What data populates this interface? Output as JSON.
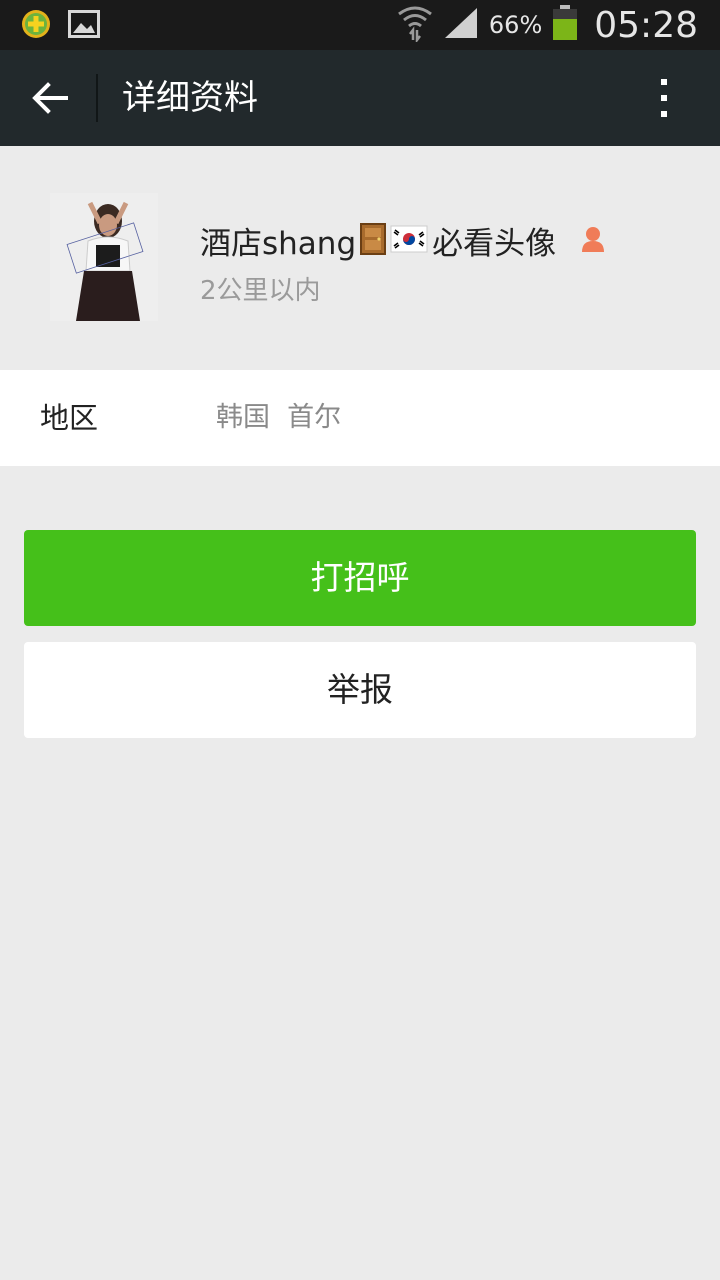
{
  "status_bar": {
    "icons_left": [
      "360-security-icon",
      "gallery-notification-icon"
    ],
    "battery_percent": "66%",
    "time": "05:28",
    "battery_level": 0.66
  },
  "action_bar": {
    "title": "详细资料"
  },
  "profile": {
    "nickname": "酒店shang",
    "nickname_suffix": "必看头像",
    "emoji_icons": [
      "door-emoji-icon",
      "korea-flag-emoji-icon"
    ],
    "gender_icon": "female-gender-icon",
    "distance": "2公里以内"
  },
  "region": {
    "label": "地区",
    "value": "韩国  首尔"
  },
  "buttons": {
    "greet": "打招呼",
    "report": "举报"
  },
  "colors": {
    "action_bar": "#22292c",
    "primary_green": "#45c01a",
    "background": "#ebebeb",
    "gender_female": "#f07c58"
  }
}
